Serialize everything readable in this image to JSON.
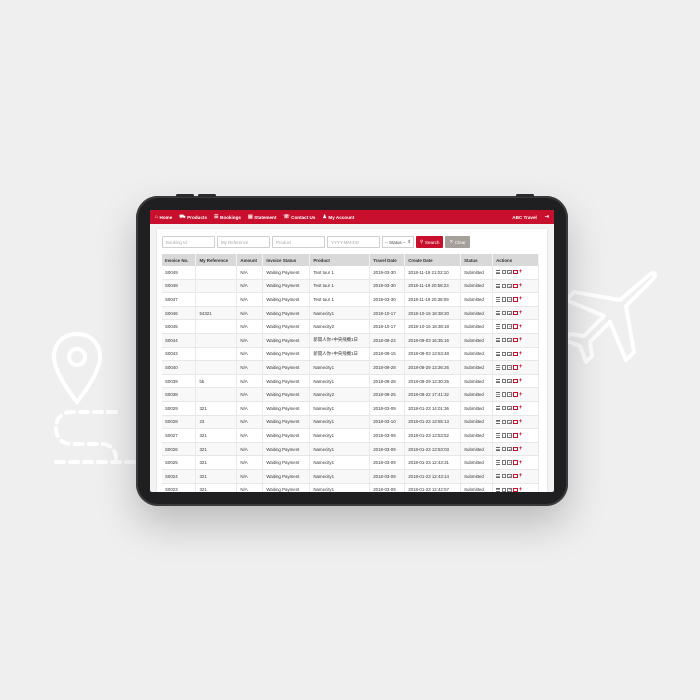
{
  "nav": {
    "items": [
      {
        "icon": "home-icon",
        "glyph": "⌂",
        "label": "Home"
      },
      {
        "icon": "car-icon",
        "glyph": "⛟",
        "label": "Products"
      },
      {
        "icon": "list-icon",
        "glyph": "☰",
        "label": "Bookings"
      },
      {
        "icon": "file-icon",
        "glyph": "▤",
        "label": "Statement"
      },
      {
        "icon": "phone-icon",
        "glyph": "☏",
        "label": "Contact Us"
      },
      {
        "icon": "user-icon",
        "glyph": "♟",
        "label": "My Account"
      }
    ],
    "brand": "ABC Travel",
    "logout_glyph": "⇥"
  },
  "filters": {
    "booking_id_placeholder": "Booking Id",
    "my_reference_placeholder": "My Reference",
    "product_placeholder": "Product",
    "date_placeholder": "YYYY-MM-DD",
    "status_selected": "-- Status --",
    "search_label": "Search",
    "clear_label": "Clear"
  },
  "table": {
    "headers": [
      "Invoice No.",
      "My Reference",
      "Amount",
      "Invoice Status",
      "Product",
      "Travel Date",
      "Create Date",
      "Status",
      "Actions"
    ],
    "rows": [
      [
        "S0049",
        "",
        "N/A",
        "Waiting Payment",
        "Test tour 1",
        "2019-03-30",
        "2018-11-19 21:02:10",
        "Submitted"
      ],
      [
        "S0048",
        "",
        "N/A",
        "Waiting Payment",
        "Test tour 1",
        "2019-03-30",
        "2018-11-19 20:58:23",
        "Submitted"
      ],
      [
        "S0047",
        "",
        "N/A",
        "Waiting Payment",
        "Test tour 1",
        "2019-03-30",
        "2018-11-19 20:38:09",
        "Submitted"
      ],
      [
        "S0046",
        "54321",
        "N/A",
        "Waiting Payment",
        "Namecity1",
        "2018-10-17",
        "2018-10-16 18:38:20",
        "Submitted"
      ],
      [
        "S0045",
        "",
        "N/A",
        "Waiting Payment",
        "Namecity2",
        "2018-10-17",
        "2018-10-16 18:38:18",
        "Submitted"
      ],
      [
        "S0044",
        "",
        "N/A",
        "Waiting Payment",
        "新開人你+中央飛機1日",
        "2018-09-22",
        "2018-09-03 16:35:16",
        "Submitted"
      ],
      [
        "S0043",
        "",
        "N/A",
        "Waiting Payment",
        "新開人你+中央飛機1日",
        "2018-09-15",
        "2018-09-03 13:53:48",
        "Submitted"
      ],
      [
        "S0040",
        "",
        "N/A",
        "Waiting Payment",
        "Namecity1",
        "2018-09-28",
        "2018-08-29 13:36:26",
        "Submitted"
      ],
      [
        "S0039",
        "bb",
        "N/A",
        "Waiting Payment",
        "Namecity1",
        "2018-09-28",
        "2018-08-29 13:30:25",
        "Submitted"
      ],
      [
        "S0038",
        "",
        "N/A",
        "Waiting Payment",
        "Namecity2",
        "2018-09-25",
        "2018-08-22 17:41:32",
        "Submitted"
      ],
      [
        "S0029",
        "321",
        "N/A",
        "Waiting Payment",
        "Namecity1",
        "2018-03-09",
        "2018-01-23 14:01:36",
        "Submitted"
      ],
      [
        "S0028",
        "23",
        "N/A",
        "Waiting Payment",
        "Namecity1",
        "2018-03-10",
        "2018-01-23 13:55:13",
        "Submitted"
      ],
      [
        "S0027",
        "321",
        "N/A",
        "Waiting Payment",
        "Namecity1",
        "2018-03-09",
        "2018-01-23 13:53:52",
        "Submitted"
      ],
      [
        "S0026",
        "321",
        "N/A",
        "Waiting Payment",
        "Namecity1",
        "2018-03-09",
        "2018-01-23 13:53:03",
        "Submitted"
      ],
      [
        "S0025",
        "321",
        "N/A",
        "Waiting Payment",
        "Namecity1",
        "2018-03-09",
        "2018-01-23 12:43:31",
        "Submitted"
      ],
      [
        "S0024",
        "321",
        "N/A",
        "Waiting Payment",
        "Namecity1",
        "2018-03-09",
        "2018-01-23 12:43:14",
        "Submitted"
      ],
      [
        "S0023",
        "321",
        "N/A",
        "Waiting Payment",
        "Namecity1",
        "2018-03-09",
        "2018-01-23 12:42:57",
        "Submitted"
      ],
      [
        "S0022",
        "321",
        "N/A",
        "Waiting Payment",
        "Namecity1",
        "2018-03-09",
        "2018-01-23 12:42:41",
        "Submitted"
      ]
    ],
    "action_icons": [
      "list-icon",
      "document-icon",
      "edit-document-icon",
      "calendar-icon",
      "add-icon"
    ]
  },
  "colors": {
    "brand_red": "#c8102e",
    "clear_gray": "#a5a09a",
    "header_gray": "#d9d9d9"
  }
}
